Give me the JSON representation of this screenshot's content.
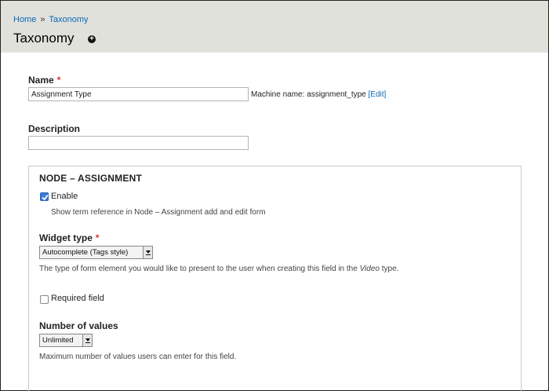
{
  "breadcrumb": {
    "home": "Home",
    "separator": "»",
    "current": "Taxonomy"
  },
  "page": {
    "title": "Taxonomy",
    "add_icon": "plus-circle-icon"
  },
  "name_field": {
    "label": "Name",
    "required_mark": "*",
    "value": "Assignment Type",
    "machine_name_prefix": "Machine name: assignment_type",
    "edit_link": "[Edit]"
  },
  "description_field": {
    "label": "Description",
    "value": ""
  },
  "node_section": {
    "legend": "NODE – ASSIGNMENT",
    "enable": {
      "label": "Enable",
      "checked": true,
      "description": "Show term reference in Node – Assignment add and edit form"
    },
    "widget_type": {
      "label": "Widget type",
      "required_mark": "*",
      "selected": "Autocomplete (Tags style)",
      "desc_before": "The type of form element you would like to present to the user when creating this field in the ",
      "desc_italic": "Video",
      "desc_after": " type."
    },
    "required_field": {
      "label": "Required field",
      "checked": false
    },
    "number_of_values": {
      "label": "Number of values",
      "selected": "Unlimited",
      "description": "Maximum number of values users can enter for this field."
    }
  },
  "colors": {
    "header_bg": "#e1e1dc",
    "link": "#0a6ab6",
    "required": "#d8392b",
    "checkbox_checked": "#3c7bd9"
  }
}
